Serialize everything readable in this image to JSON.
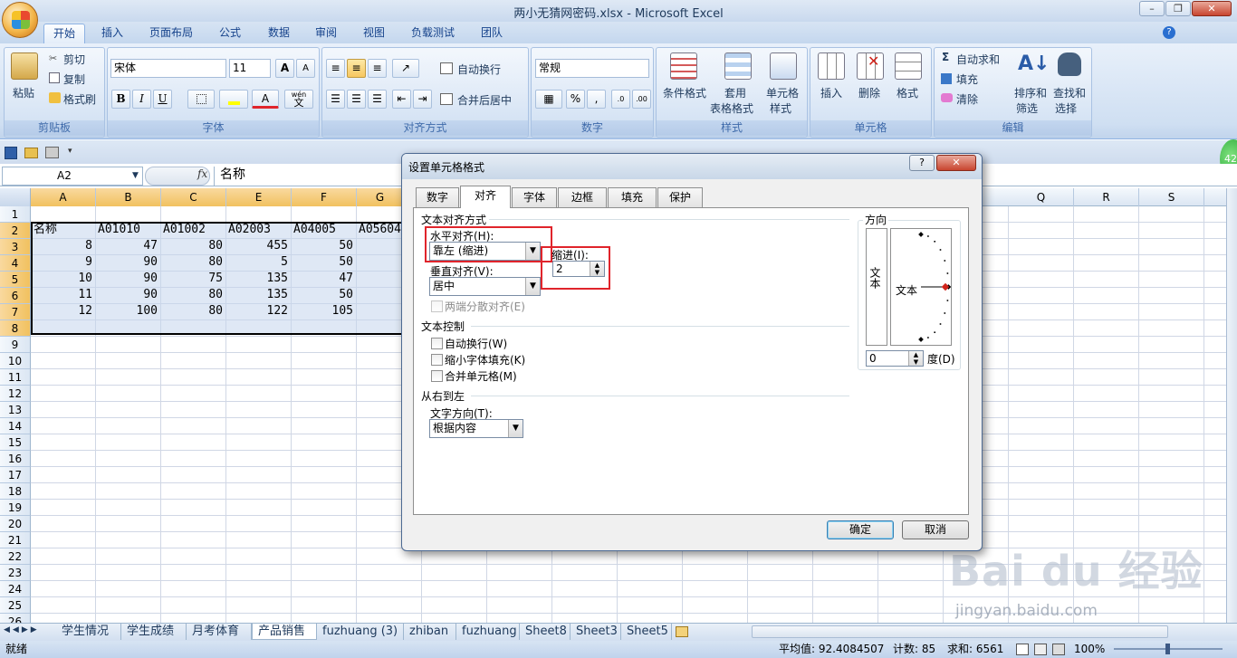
{
  "window": {
    "title": "两小无猜网密码.xlsx - Microsoft Excel",
    "min": "–",
    "restore": "❐",
    "close": "✕"
  },
  "ribbon": {
    "tabs": [
      "开始",
      "插入",
      "页面布局",
      "公式",
      "数据",
      "审阅",
      "视图",
      "负载测试",
      "团队"
    ],
    "clipboard": {
      "paste": "粘贴",
      "cut": "剪切",
      "copy": "复制",
      "painter": "格式刷",
      "label": "剪贴板"
    },
    "font": {
      "name": "宋体",
      "size": "11",
      "bold": "B",
      "italic": "I",
      "underline": "U",
      "label": "字体",
      "grow": "A",
      "shrink": "A",
      "color": "A",
      "wen": "wén",
      "wenchar": "文"
    },
    "align": {
      "wrap": "自动换行",
      "merge": "合并后居中",
      "label": "对齐方式"
    },
    "number": {
      "format": "常规",
      "percent": "%",
      "comma": ",",
      "label": "数字"
    },
    "styles": {
      "cond": "条件格式",
      "table1": "套用",
      "table2": "表格格式",
      "cell1": "单元格",
      "cell2": "样式",
      "label": "样式"
    },
    "cells": {
      "insert": "插入",
      "delete": "删除",
      "format": "格式",
      "label": "单元格"
    },
    "edit": {
      "autosum": "自动求和",
      "fill": "填充",
      "clear": "清除",
      "sort1": "排序和",
      "sort2": "筛选",
      "find1": "查找和",
      "find2": "选择",
      "label": "编辑",
      "sigma": "Σ"
    }
  },
  "formula": {
    "namebox": "A2",
    "fx": "fx",
    "value": "名称"
  },
  "columns": [
    "A",
    "B",
    "C",
    "E",
    "F",
    "G",
    "Q",
    "R",
    "S"
  ],
  "rows": [
    "1",
    "2",
    "3",
    "4",
    "5",
    "6",
    "7",
    "8",
    "9",
    "10",
    "11",
    "12",
    "13",
    "14",
    "15",
    "16",
    "17",
    "18",
    "19",
    "20",
    "21",
    "22",
    "23",
    "24",
    "25",
    "26"
  ],
  "table": {
    "header": [
      "名称",
      "A01010",
      "A01002",
      "A02003",
      "A04005",
      "A05604"
    ],
    "data": [
      [
        "8",
        "47",
        "80",
        "455",
        "50"
      ],
      [
        "9",
        "90",
        "80",
        "5",
        "50"
      ],
      [
        "10",
        "90",
        "75",
        "135",
        "47"
      ],
      [
        "11",
        "90",
        "80",
        "135",
        "50"
      ],
      [
        "12",
        "100",
        "80",
        "122",
        "105"
      ]
    ]
  },
  "sheets": [
    "学生情况",
    "学生成绩",
    "月考体育",
    "产品销售",
    "fuzhuang (3)",
    "zhiban",
    "fuzhuang",
    "Sheet8",
    "Sheet3",
    "Sheet5"
  ],
  "status": {
    "ready": "就绪",
    "avg": "平均值: 92.4084507",
    "count": "计数: 85",
    "sum": "求和: 6561",
    "zoom": "100%",
    "badge": "42"
  },
  "dialog": {
    "title": "设置单元格格式",
    "help": "?",
    "close": "✕",
    "tabs": [
      "数字",
      "对齐",
      "字体",
      "边框",
      "填充",
      "保护"
    ],
    "text_align": "文本对齐方式",
    "h_align_label": "水平对齐(H):",
    "h_align_value": "靠左 (缩进)",
    "indent_label": "缩进(I):",
    "indent_value": "2",
    "v_align_label": "垂直对齐(V):",
    "v_align_value": "居中",
    "justify": "两端分散对齐(E)",
    "text_control": "文本控制",
    "wrap": "自动换行(W)",
    "shrink": "缩小字体填充(K)",
    "merge": "合并单元格(M)",
    "rtl": "从右到左",
    "text_dir_label": "文字方向(T):",
    "text_dir_value": "根据内容",
    "orientation": "方向",
    "vertical_text": "文本",
    "orient_text": "文本",
    "degree_value": "0",
    "degree_label": "度(D)",
    "ok": "确定",
    "cancel": "取消"
  },
  "watermark": {
    "brand": "Bai du 经验",
    "url": "jingyan.baidu.com"
  }
}
